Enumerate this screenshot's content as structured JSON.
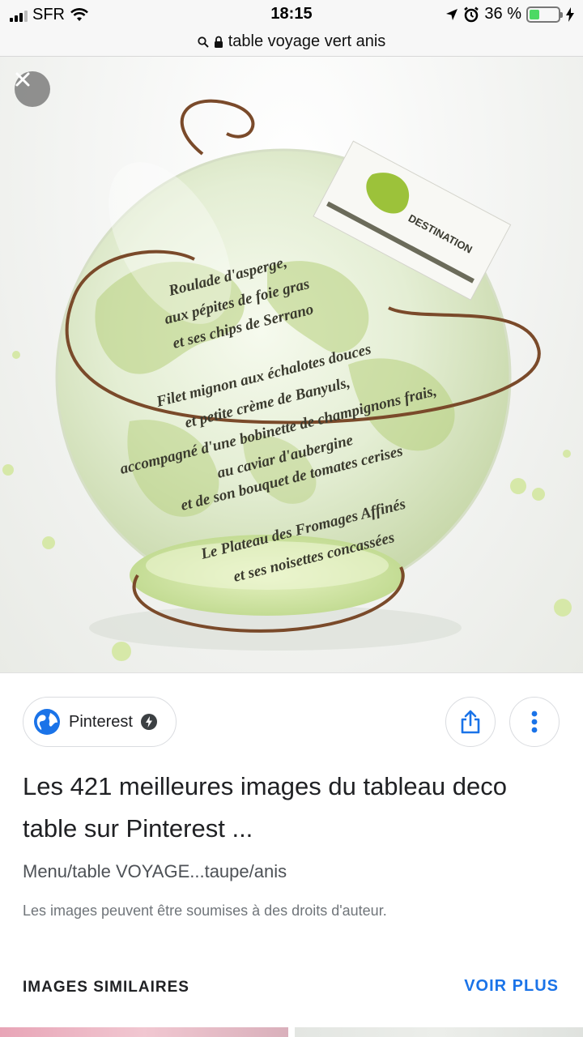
{
  "status_bar": {
    "carrier": "SFR",
    "time": "18:15",
    "battery_percent": "36 %",
    "battery_level": 0.36
  },
  "url_bar": {
    "query": "table voyage vert anis"
  },
  "image": {
    "tag_text": "DESTINATION",
    "menu_lines": [
      "Roulade d'asperge,",
      "aux pépites de foie gras",
      "et ses chips de Serrano",
      "Filet mignon aux échalotes douces",
      "et petite crème de Banyuls,",
      "accompagné d'une bobinette de champignons frais,",
      "au caviar d'aubergine",
      "et de son bouquet de tomates cerises",
      "Le Plateau des Fromages Affinés",
      "et ses noisettes concassées"
    ]
  },
  "result": {
    "source": "Pinterest",
    "title": "Les 421 meilleures images du tableau deco table sur Pinterest ...",
    "subtitle": "Menu/table VOYAGE...taupe/anis",
    "copyright": "Les images peuvent être soumises à des droits d'auteur."
  },
  "similar": {
    "label": "IMAGES SIMILAIRES",
    "see_more": "VOIR PLUS"
  },
  "icons": [
    "signal-icon",
    "wifi-icon",
    "search-icon",
    "lock-icon",
    "location-arrow-icon",
    "alarm-icon",
    "battery-icon",
    "charging-icon",
    "close-icon",
    "globe-icon",
    "amp-bolt-icon",
    "share-icon",
    "more-vert-icon"
  ],
  "colors": {
    "accent": "#1a73e8",
    "battery_fill": "#4cd964",
    "globe_blue": "#1a73e8"
  }
}
